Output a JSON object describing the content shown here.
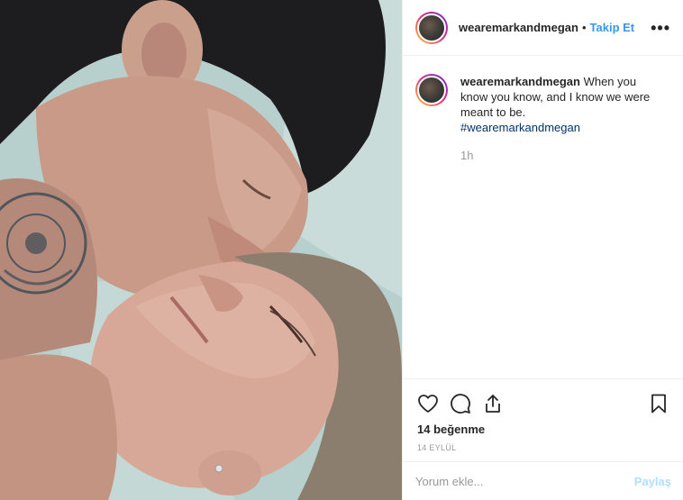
{
  "post": {
    "username": "wearemarkandmegan",
    "separator": "•",
    "follow_label": "Takip Et",
    "more_label": "•••"
  },
  "caption": {
    "username": "wearemarkandmegan",
    "text": "When you know you know, and I know we were meant to be.",
    "hashtag": "#wearemarkandmegan",
    "time": "1h"
  },
  "actions": {
    "like_icon": "heart-icon",
    "comment_icon": "comment-icon",
    "share_icon": "share-icon",
    "save_icon": "bookmark-icon",
    "likes_text": "14 beğenme",
    "date_text": "14 EYLÜL"
  },
  "comment": {
    "placeholder": "Yorum ekle...",
    "post_label": "Paylaş"
  },
  "colors": {
    "link": "#3897f0",
    "hashtag": "#003569",
    "muted": "#999999",
    "post_disabled": "#b2dffc"
  }
}
